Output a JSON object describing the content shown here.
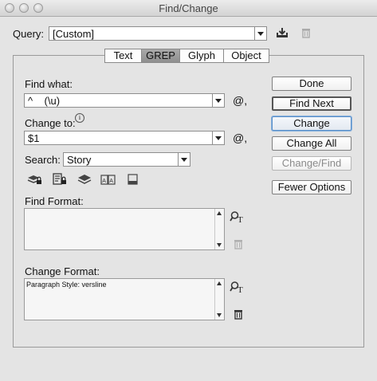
{
  "window": {
    "title": "Find/Change"
  },
  "query": {
    "label": "Query:",
    "value": "[Custom]"
  },
  "tabs": [
    {
      "label": "Text",
      "active": false
    },
    {
      "label": "GREP",
      "active": true
    },
    {
      "label": "Glyph",
      "active": false
    },
    {
      "label": "Object",
      "active": false
    }
  ],
  "find_what": {
    "label": "Find what:",
    "value": "^    (\\u)",
    "special_char": "@,"
  },
  "change_to": {
    "label": "Change to:",
    "info": "i",
    "value": "$1",
    "special_char": "@,"
  },
  "search": {
    "label": "Search:",
    "value": "Story"
  },
  "find_format": {
    "label": "Find Format:",
    "value": ""
  },
  "change_format": {
    "label": "Change Format:",
    "value": "Paragraph Style: versline"
  },
  "buttons": {
    "done": "Done",
    "find_next": "Find Next",
    "change": "Change",
    "change_all": "Change All",
    "change_find": "Change/Find",
    "fewer_options": "Fewer Options"
  },
  "icons": {
    "save_query": "save-query-icon",
    "delete_query": "trash-icon",
    "options": [
      "locked-layers-icon",
      "locked-stories-icon",
      "hidden-layers-icon",
      "master-pages-icon",
      "footnotes-icon"
    ]
  }
}
